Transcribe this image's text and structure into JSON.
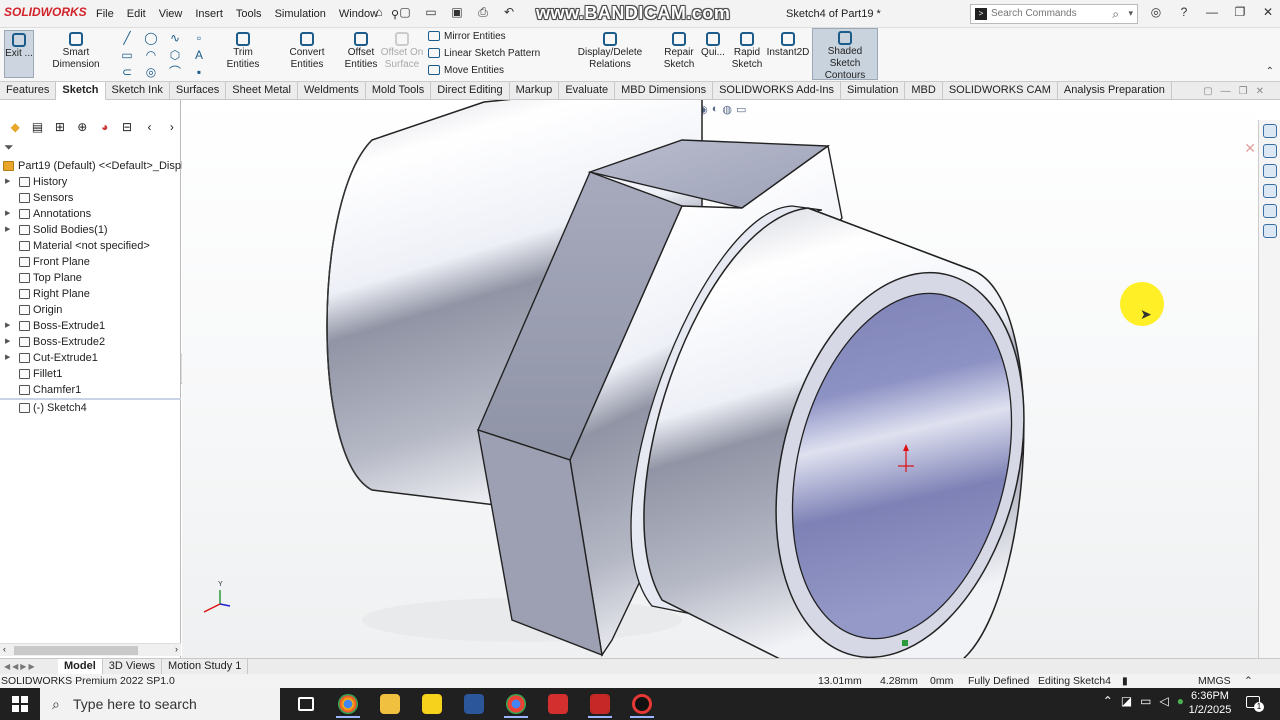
{
  "app": {
    "logo": "SOLIDWORKS",
    "menus": [
      "File",
      "Edit",
      "View",
      "Insert",
      "Tools",
      "Simulation",
      "Window"
    ],
    "watermark": "www.BANDICAM.com",
    "document_title": "Sketch4 of Part19 *",
    "search_placeholder": "Search Commands"
  },
  "ribbon": {
    "exit": "Exit ...",
    "smart_dimension": "Smart Dimension",
    "trim": "Trim Entities",
    "convert": "Convert Entities",
    "offset": "Offset Entities",
    "offset_surface": "Offset On Surface",
    "mirror": "Mirror Entities",
    "linear_pattern": "Linear Sketch Pattern",
    "move": "Move Entities",
    "relations": "Display/Delete Relations",
    "repair": "Repair Sketch",
    "quick": "Qui...",
    "rapid": "Rapid Sketch",
    "instant2d": "Instant2D",
    "shaded": "Shaded Sketch Contours"
  },
  "cm_tabs": [
    "Features",
    "Sketch",
    "Sketch Ink",
    "Surfaces",
    "Sheet Metal",
    "Weldments",
    "Mold Tools",
    "Direct Editing",
    "Markup",
    "Evaluate",
    "MBD Dimensions",
    "SOLIDWORKS Add-Ins",
    "Simulation",
    "MBD",
    "SOLIDWORKS CAM",
    "Analysis Preparation"
  ],
  "active_cm_tab": "Sketch",
  "tree": {
    "root": "Part19 (Default) <<Default>_Display",
    "items": [
      "History",
      "Sensors",
      "Annotations",
      "Solid Bodies(1)",
      "Material <not specified>",
      "Front Plane",
      "Top Plane",
      "Right Plane",
      "Origin",
      "Boss-Extrude1",
      "Boss-Extrude2",
      "Cut-Extrude1",
      "Fillet1",
      "Chamfer1",
      "(-) Sketch4"
    ]
  },
  "model_tabs": [
    "Model",
    "3D Views",
    "Motion Study 1"
  ],
  "status": {
    "product": "SOLIDWORKS Premium 2022 SP1.0",
    "x": "13.01mm",
    "y": "4.28mm",
    "z": "0mm",
    "state": "Fully Defined",
    "editing": "Editing Sketch4",
    "units": "MMGS"
  },
  "taskbar": {
    "search_placeholder": "Type here to search",
    "time": "6:36PM",
    "date": "1/2/2025"
  },
  "colors": {
    "accent": "#1b5c8a",
    "model_light": "#f4f5fa",
    "model_dark": "#858a9e",
    "bore": "#8d92c4"
  }
}
